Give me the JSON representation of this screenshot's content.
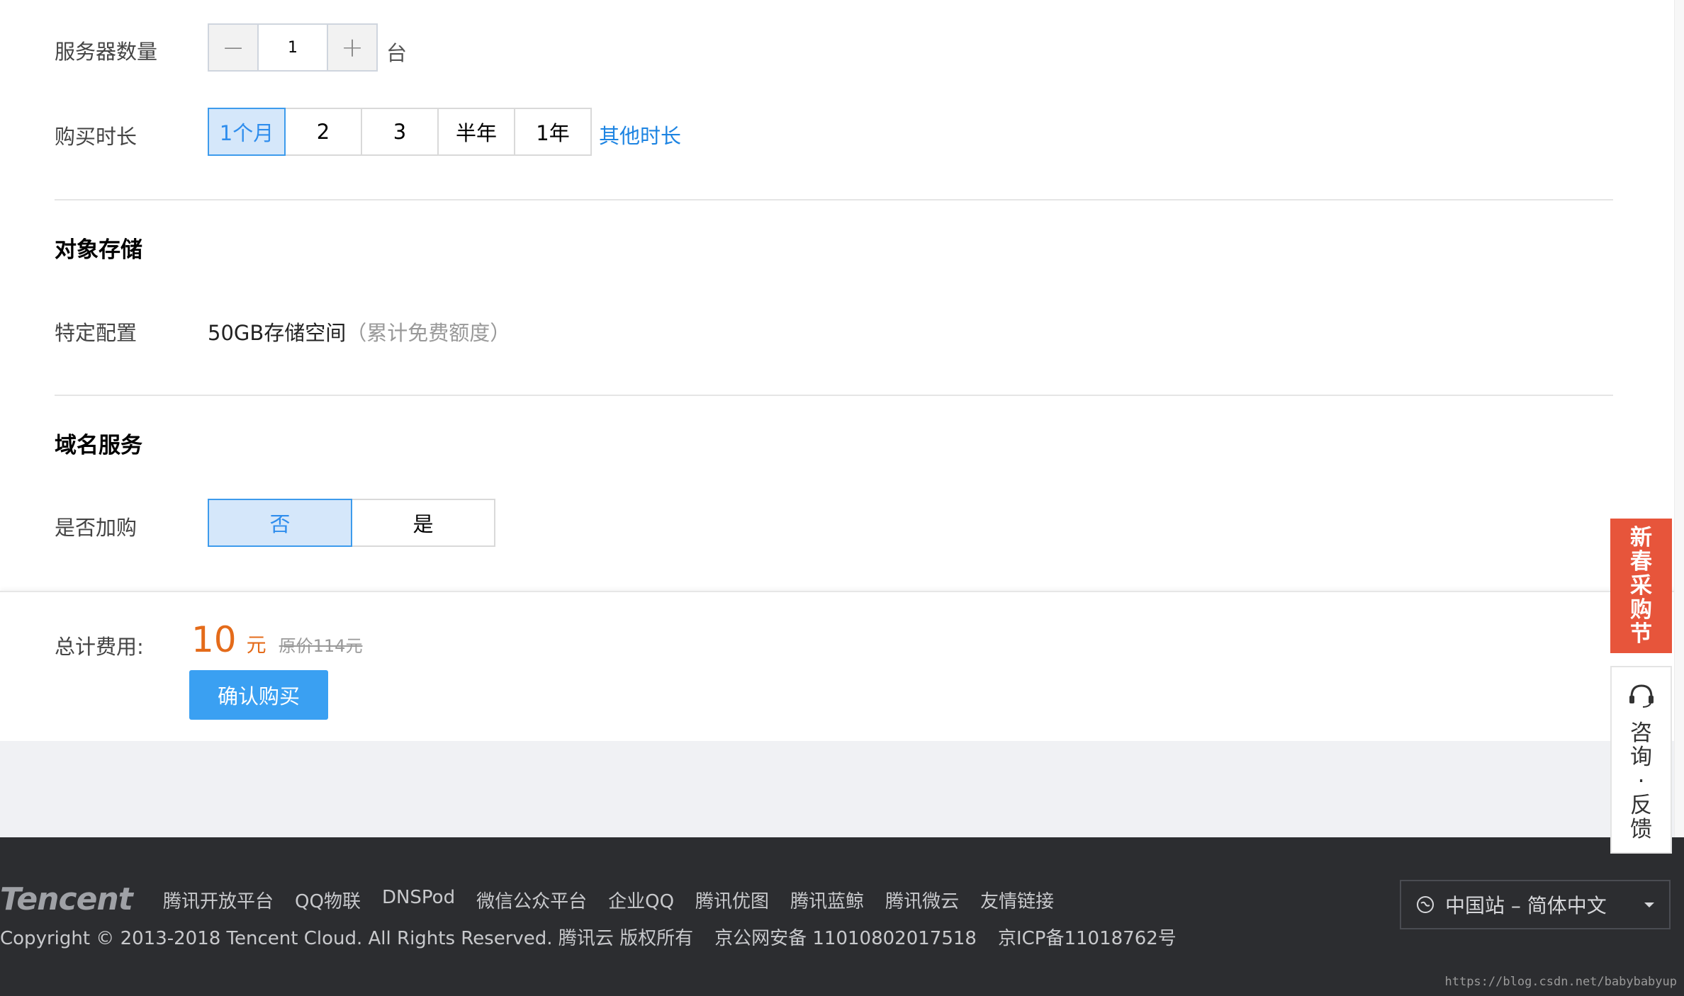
{
  "server_count": {
    "label": "服务器数量",
    "minus": "−",
    "value": "1",
    "plus": "+",
    "unit": "台"
  },
  "duration": {
    "label": "购买时长",
    "options": [
      "1个月",
      "2",
      "3",
      "半年",
      "1年"
    ],
    "selected": "1个月",
    "other_link": "其他时长"
  },
  "object_storage": {
    "title": "对象存储",
    "config_label": "特定配置",
    "config_value": "50GB存储空间",
    "config_note": "（累计免费额度）"
  },
  "domain_service": {
    "title": "域名服务",
    "label": "是否加购",
    "options": [
      "否",
      "是"
    ],
    "selected": "否"
  },
  "total": {
    "label": "总计费用:",
    "amount": "10",
    "currency": "元",
    "original": "原价114元",
    "confirm_button": "确认购买"
  },
  "side": {
    "promo_chars": [
      "新",
      "春",
      "采",
      "购",
      "节"
    ],
    "consult_chars": [
      "咨",
      "询",
      "·",
      "反",
      "馈"
    ]
  },
  "footer": {
    "logo": "Tencent",
    "links": [
      "腾讯开放平台",
      "QQ物联",
      "DNSPod",
      "微信公众平台",
      "企业QQ",
      "腾讯优图",
      "腾讯蓝鲸",
      "腾讯微云",
      "友情链接"
    ],
    "copyright": "Copyright © 2013-2018 Tencent Cloud. All Rights Reserved. 腾讯云 版权所有",
    "beian": "京公网安备 11010802017518",
    "icp": "京ICP备11018762号",
    "region": "中国站 – 简体中文"
  },
  "watermark": "https://blog.csdn.net/babybabyup",
  "colors": {
    "accent": "#2e8ded",
    "price": "#e46b1a",
    "button": "#3aa0f2",
    "promo": "#e7553b",
    "footer_bg": "#2c2d30"
  }
}
